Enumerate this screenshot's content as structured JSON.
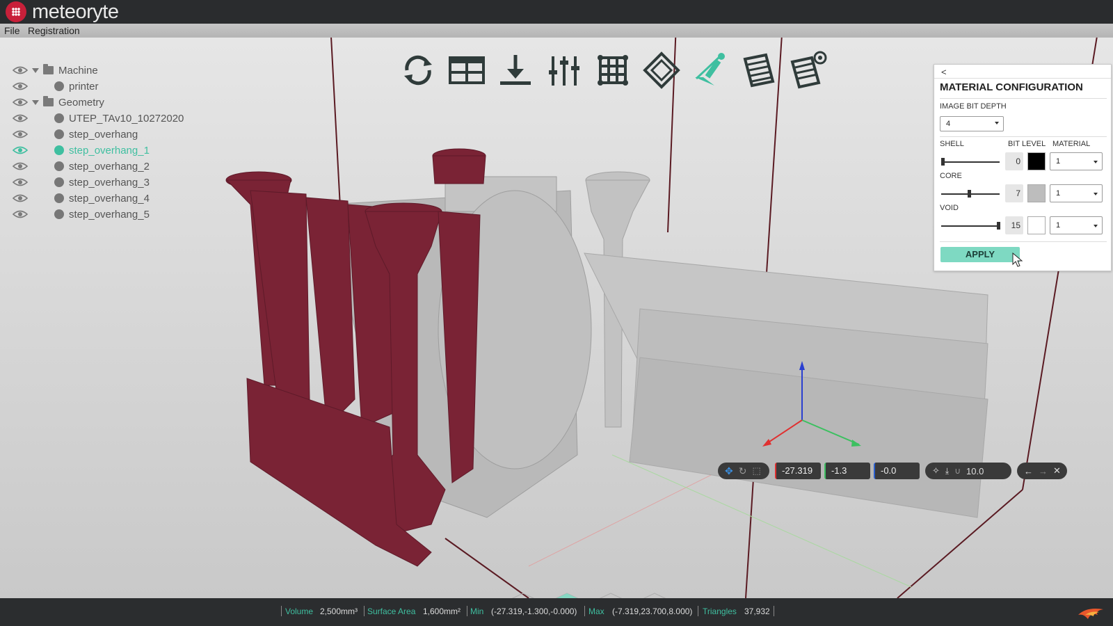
{
  "app": {
    "name": "meteoryte"
  },
  "menu": {
    "items": [
      "File",
      "Registration"
    ]
  },
  "tree": [
    {
      "label": "Machine",
      "type": "folder",
      "level": 0,
      "selected": false
    },
    {
      "label": "printer",
      "type": "object",
      "level": 1,
      "selected": false
    },
    {
      "label": "Geometry",
      "type": "folder",
      "level": 0,
      "selected": false
    },
    {
      "label": "UTEP_TAv10_10272020",
      "type": "object",
      "level": 1,
      "selected": false
    },
    {
      "label": "step_overhang",
      "type": "object",
      "level": 1,
      "selected": false
    },
    {
      "label": "step_overhang_1",
      "type": "object",
      "level": 1,
      "selected": true
    },
    {
      "label": "step_overhang_2",
      "type": "object",
      "level": 1,
      "selected": false
    },
    {
      "label": "step_overhang_3",
      "type": "object",
      "level": 1,
      "selected": false
    },
    {
      "label": "step_overhang_4",
      "type": "object",
      "level": 1,
      "selected": false
    },
    {
      "label": "step_overhang_5",
      "type": "object",
      "level": 1,
      "selected": false
    }
  ],
  "toolbar": {
    "tools": [
      "refresh-icon",
      "layout-icon",
      "download-icon",
      "sliders-icon",
      "grid-icon",
      "diamond-icon",
      "pen-icon",
      "slice-stack-icon",
      "slice-preview-icon"
    ],
    "active_tool": "pen-icon"
  },
  "material_panel": {
    "collapse": "<",
    "title": "MATERIAL CONFIGURATION",
    "image_bit_depth_label": "IMAGE BIT DEPTH",
    "image_bit_depth_value": "4",
    "header_shell": "SHELL",
    "header_bit_level": "BIT LEVEL",
    "header_material": "MATERIAL",
    "rows": [
      {
        "label": "SHELL",
        "bit_level": "0",
        "slider_fraction": 0.0,
        "swatch_color": "#000000",
        "material": "1"
      },
      {
        "label": "CORE",
        "bit_level": "7",
        "slider_fraction": 0.47,
        "swatch_color": "#bdbdbd",
        "material": "1"
      },
      {
        "label": "VOID",
        "bit_level": "15",
        "slider_fraction": 1.0,
        "swatch_color": "#ffffff",
        "material": "1"
      }
    ],
    "apply_label": "APPLY"
  },
  "transform_bar": {
    "x": "-27.319",
    "y": "-1.3",
    "z": "-0.0",
    "snap": "10.0"
  },
  "status": {
    "volume_label": "Volume",
    "volume_value": "2,500mm³",
    "area_label": "Surface Area",
    "area_value": "1,600mm²",
    "min_label": "Min",
    "min_value": "(-27.319,-1.300,-0.000)",
    "max_label": "Max",
    "max_value": "(-7.319,23.700,8.000)",
    "tri_label": "Triangles",
    "tri_value": "37,932"
  },
  "colors": {
    "accent": "#3fbfa0",
    "part_selected": "#7a2335",
    "part_default": "#b9b9b9",
    "build_box": "#5a1a22"
  }
}
